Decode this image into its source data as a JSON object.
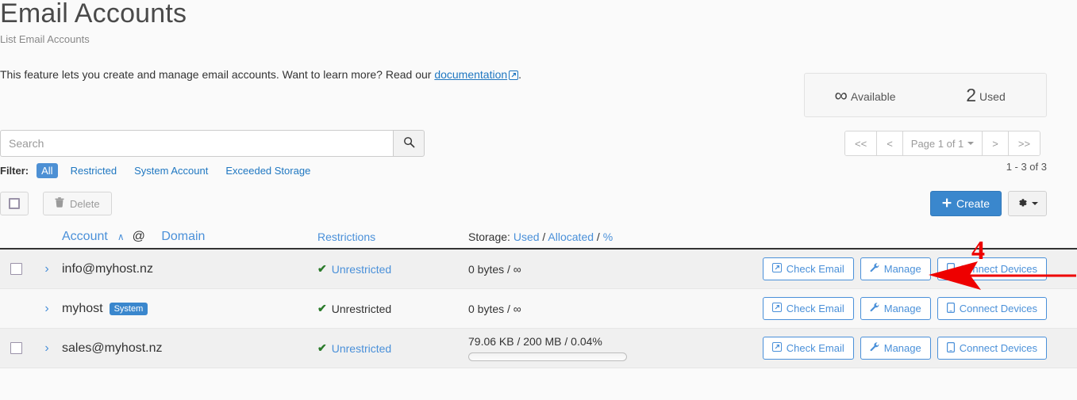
{
  "header": {
    "title": "Email Accounts",
    "subtitle": "List Email Accounts",
    "intro_prefix": "This feature lets you create and manage email accounts. Want to learn more? Read our ",
    "intro_link": "documentation",
    "intro_suffix": "."
  },
  "stats": {
    "available_value": "∞",
    "available_label": "Available",
    "used_value": "2",
    "used_label": "Used"
  },
  "search": {
    "placeholder": "Search",
    "value": "",
    "icon": "search-icon"
  },
  "filter": {
    "label": "Filter:",
    "items": [
      {
        "label": "All",
        "active": true
      },
      {
        "label": "Restricted",
        "active": false
      },
      {
        "label": "System Account",
        "active": false
      },
      {
        "label": "Exceeded Storage",
        "active": false
      }
    ]
  },
  "pagination": {
    "first": "<<",
    "prev": "<",
    "page_label": "Page 1 of 1",
    "next": ">",
    "last": ">>",
    "range_text": "1 - 3 of 3"
  },
  "toolbar": {
    "select_all_icon": "checkbox-icon",
    "delete_label": "Delete",
    "delete_icon": "trash-icon",
    "create_label": "Create",
    "create_icon": "plus-icon",
    "settings_icon": "gear-icon"
  },
  "table": {
    "headers": {
      "account": "Account",
      "sort_caret": "∧",
      "at": "@",
      "domain": "Domain",
      "restrictions": "Restrictions",
      "storage_prefix": "Storage:",
      "storage_used": "Used",
      "sep1": "/",
      "storage_allocated": "Allocated",
      "sep2": "/",
      "storage_percent": "%"
    },
    "rows": [
      {
        "account": "info@myhost.nz",
        "badge": "",
        "has_checkbox": true,
        "restriction": "Unrestricted",
        "restriction_is_link": true,
        "storage": "0 bytes / ∞",
        "has_progress": false,
        "progress_percent": 0,
        "highlighted": true,
        "actions": [
          {
            "label": "Check Email",
            "icon": "external-link-icon"
          },
          {
            "label": "Manage",
            "icon": "wrench-icon"
          },
          {
            "label": "Connect Devices",
            "icon": "mobile-icon"
          }
        ]
      },
      {
        "account": "myhost",
        "badge": "System",
        "has_checkbox": false,
        "restriction": "Unrestricted",
        "restriction_is_link": false,
        "storage": "0 bytes / ∞",
        "has_progress": false,
        "progress_percent": 0,
        "highlighted": false,
        "actions": [
          {
            "label": "Check Email",
            "icon": "external-link-icon"
          },
          {
            "label": "Manage",
            "icon": "wrench-icon"
          },
          {
            "label": "Connect Devices",
            "icon": "mobile-icon"
          }
        ]
      },
      {
        "account": "sales@myhost.nz",
        "badge": "",
        "has_checkbox": true,
        "restriction": "Unrestricted",
        "restriction_is_link": true,
        "storage": "79.06 KB / 200 MB / 0.04%",
        "has_progress": true,
        "progress_percent": 0.04,
        "highlighted": false,
        "actions": [
          {
            "label": "Check Email",
            "icon": "external-link-icon"
          },
          {
            "label": "Manage",
            "icon": "wrench-icon"
          },
          {
            "label": "Connect Devices",
            "icon": "mobile-icon"
          }
        ]
      }
    ]
  },
  "annotation": {
    "number": "4",
    "color": "#ee0000",
    "points_at": "Manage"
  }
}
